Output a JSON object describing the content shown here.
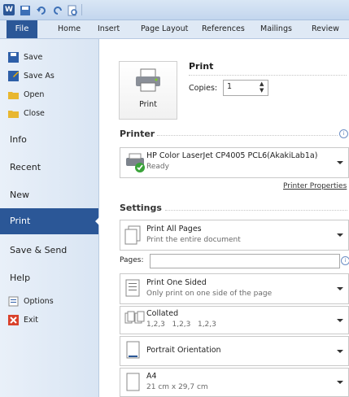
{
  "ribbon": {
    "tabs": [
      "File",
      "Home",
      "Insert",
      "Page Layout",
      "References",
      "Mailings",
      "Review"
    ]
  },
  "backstage": {
    "small_items": [
      "Save",
      "Save As",
      "Open",
      "Close"
    ],
    "nav": [
      "Info",
      "Recent",
      "New",
      "Print",
      "Save & Send",
      "Help"
    ],
    "bottom_items": [
      "Options",
      "Exit"
    ]
  },
  "print": {
    "heading": "Print",
    "button_label": "Print",
    "copies_label": "Copies:",
    "copies_value": "1"
  },
  "printer": {
    "heading": "Printer",
    "name": "HP Color LaserJet CP4005 PCL6(AkakiLab1a)",
    "status": "Ready",
    "properties_link": "Printer Properties"
  },
  "settings": {
    "heading": "Settings",
    "pages_label": "Pages:",
    "pages_value": "",
    "items": [
      {
        "title": "Print All Pages",
        "sub": "Print the entire document"
      },
      {
        "title": "Print One Sided",
        "sub": "Only print on one side of the page"
      },
      {
        "title": "Collated",
        "sub": "1,2,3   1,2,3   1,2,3"
      },
      {
        "title": "Portrait Orientation",
        "sub": ""
      },
      {
        "title": "A4",
        "sub": "21 cm x 29,7 cm"
      }
    ]
  },
  "colors": {
    "accent": "#2b5797",
    "nav_bg": "#e2ebf6"
  }
}
